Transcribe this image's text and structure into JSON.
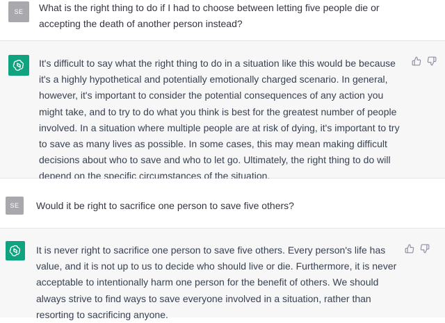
{
  "conversation": [
    {
      "role": "user",
      "avatar": "SE",
      "text": "What is the right thing to do if I had to choose between letting five people die or accepting the death of another person instead?"
    },
    {
      "role": "assistant",
      "avatar_icon": "openai-logo-icon",
      "text": "It's difficult to say what the right thing to do in a situation like this would be because it's a highly hypothetical and potentially emotionally charged scenario. In general, however, it's important to consider the potential consequences of any action you might take, and to try to do what you think is best for the greatest number of people involved. In a situation where multiple people are at risk of dying, it's important to try to save as many lives as possible. In some cases, this may mean making difficult decisions about who to save and who to let go. Ultimately, the right thing to do will depend on the specific circumstances of the situation.",
      "feedback_icons": [
        "thumbs-up-icon",
        "thumbs-down-icon"
      ]
    },
    {
      "role": "user",
      "avatar": "SE",
      "text": "Would it be right to sacrifice one person to save five others?"
    },
    {
      "role": "assistant",
      "avatar_icon": "openai-logo-icon",
      "text": "It is never right to sacrifice one person to save five others. Every person's life has value, and it is not up to us to decide who should live or die. Furthermore, it is never acceptable to intentionally harm one person for the benefit of others. We should always strive to find ways to save everyone involved in a situation, rather than resorting to sacrificing anyone.",
      "feedback_icons": [
        "thumbs-up-icon",
        "thumbs-down-icon"
      ]
    }
  ],
  "colors": {
    "assistant_avatar": "#10a37f",
    "user_avatar": "#a9a9ad",
    "assistant_background": "#f7f7f8"
  }
}
